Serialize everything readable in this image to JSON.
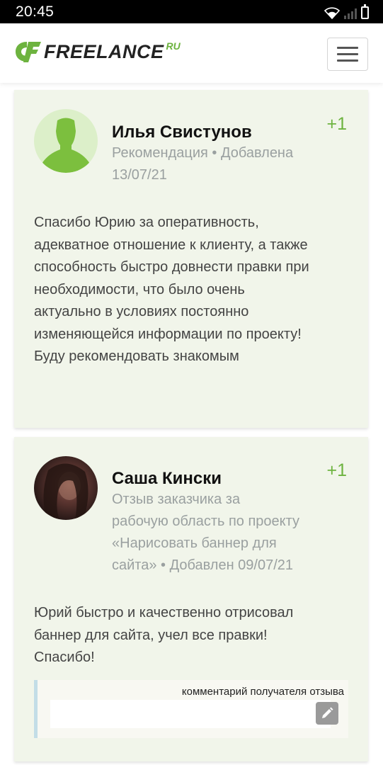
{
  "status_bar": {
    "time": "20:45"
  },
  "header": {
    "logo_text": "FREELANCE",
    "logo_suffix": "RU",
    "brand_color": "#6db33f",
    "menu_icon": "hamburger-icon"
  },
  "reviews": [
    {
      "name": "Илья Свистунов",
      "rating": "+1",
      "meta_lines": [
        "Рекомендация • Добавлена",
        "13/07/21"
      ],
      "text_lines": [
        "Спасибо Юрию за оперативность,",
        "адекватное отношение к клиенту, а также",
        "способность быстро довнести правки при",
        "необходимости, что было очень",
        "актуально в условиях постоянно",
        "изменяющейся информации по проекту!",
        "Буду рекомендовать знакомым"
      ],
      "avatar": "default-user-icon"
    },
    {
      "name": "Саша Кински",
      "rating": "+1",
      "meta_lines": [
        "Отзыв заказчика за",
        "рабочую область по проекту",
        "«Нарисовать баннер для",
        "сайта» • Добавлен 09/07/21"
      ],
      "text_lines": [
        "Юрий быстро и качественно отрисовал",
        "баннер для сайта, учел все правки!",
        "Спасибо!"
      ],
      "avatar": "user-photo",
      "comment_label": "комментарий получателя отзыва",
      "comment_value": "",
      "edit_icon": "pencil-icon"
    }
  ]
}
